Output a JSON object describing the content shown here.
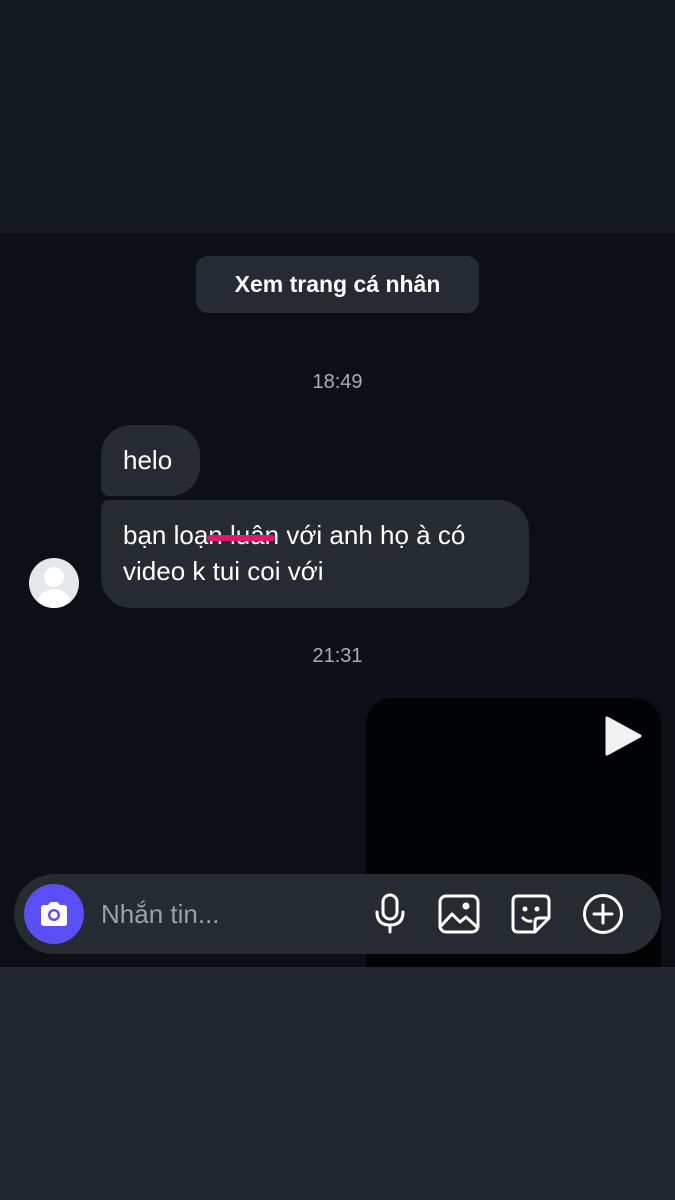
{
  "chat": {
    "profile_button_label": "Xem trang cá nhân",
    "messages": [
      {
        "timestamp": "18:49"
      },
      {
        "text": "helo"
      },
      {
        "text": "bạn loạn luân với anh họ à có\nvideo k tui coi với"
      },
      {
        "timestamp": "21:31"
      }
    ],
    "video_icon": "play-icon"
  },
  "composer": {
    "placeholder": "Nhắn tin...",
    "value": "",
    "icons": [
      "camera-icon",
      "microphone-icon",
      "image-icon",
      "sticker-icon",
      "plus-circle-icon"
    ],
    "camera_color": "#5a4ef7"
  },
  "colors": {
    "background": "#0c0f15",
    "bubble": "#262a31",
    "redaction_mark": "#e8146e"
  }
}
